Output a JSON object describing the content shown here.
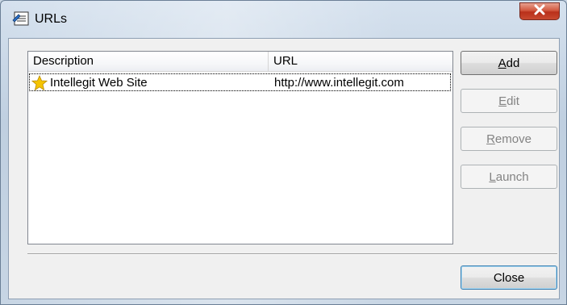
{
  "window": {
    "title": "URLs"
  },
  "list": {
    "columns": [
      "Description",
      "URL"
    ],
    "rows": [
      {
        "description": "Intellegit Web Site",
        "url": "http://www.intellegit.com",
        "icon": "star-icon"
      }
    ]
  },
  "buttons": {
    "add": {
      "first": "A",
      "rest": "dd"
    },
    "edit": {
      "first": "E",
      "rest": "dit"
    },
    "remove": {
      "first": "R",
      "rest": "emove"
    },
    "launch": {
      "first": "L",
      "rest": "aunch"
    },
    "close": {
      "label": "Close"
    }
  },
  "colors": {
    "accent": "#3c7fb1",
    "close_button": "#c8492f",
    "star": "#f5c400"
  }
}
